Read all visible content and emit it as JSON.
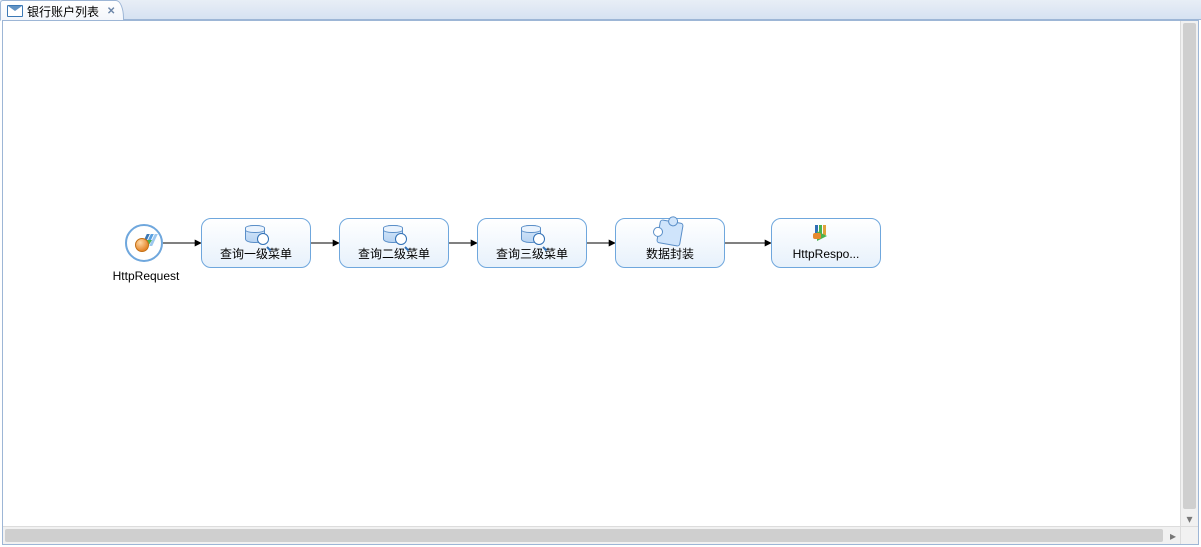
{
  "tab": {
    "icon": "envelope-icon",
    "title": "银行账户列表",
    "close_glyph": "✕"
  },
  "flow": {
    "start": {
      "label": "HttpRequest",
      "icon": "request-icon"
    },
    "nodes": [
      {
        "id": "n1",
        "label": "查询一级菜单",
        "icon": "database-search-icon"
      },
      {
        "id": "n2",
        "label": "查询二级菜单",
        "icon": "database-search-icon"
      },
      {
        "id": "n3",
        "label": "查询三级菜单",
        "icon": "database-search-icon"
      },
      {
        "id": "n4",
        "label": "数据封装",
        "icon": "puzzle-icon"
      },
      {
        "id": "n5",
        "label": "HttpRespo...",
        "icon": "response-icon"
      }
    ],
    "edges": [
      {
        "from": "start",
        "to": "n1"
      },
      {
        "from": "n1",
        "to": "n2"
      },
      {
        "from": "n2",
        "to": "n3"
      },
      {
        "from": "n3",
        "to": "n4"
      },
      {
        "from": "n4",
        "to": "n5"
      }
    ]
  },
  "colors": {
    "node_border": "#6fa7dd",
    "tab_border": "#9db6d6"
  }
}
